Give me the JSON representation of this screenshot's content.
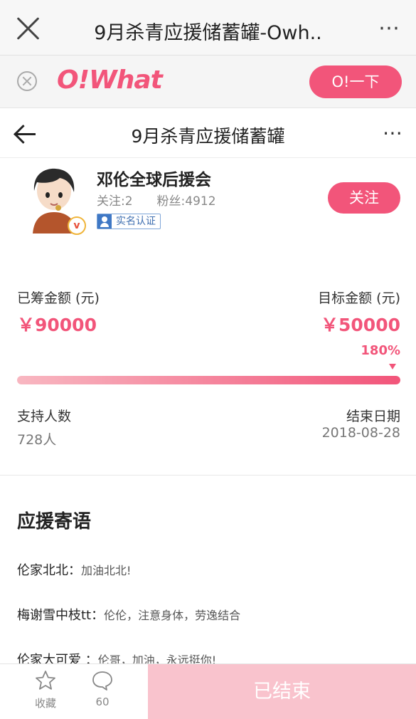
{
  "browser": {
    "title": "9月杀青应援储蓄罐-Owh..",
    "more_icon": "⋯"
  },
  "banner": {
    "logo_text": "O!What",
    "open_button": "O!一下"
  },
  "header": {
    "title": "9月杀青应援储蓄罐",
    "more_icon": "⋯"
  },
  "profile": {
    "name": "邓伦全球后援会",
    "following": "关注:2",
    "fans": "粉丝:4912",
    "verified_badge": "实名认证",
    "v_badge": "v",
    "follow_button": "关注"
  },
  "funding": {
    "raised_label": "已筹金额 (元)",
    "raised_value": "￥90000",
    "target_label": "目标金额 (元)",
    "target_value": "￥50000",
    "progress_text": "180%",
    "progress_fraction": 1.0,
    "supporters_label": "支持人数",
    "supporters_value": "728人",
    "end_date_label": "结束日期",
    "end_date_value": "2018-08-28"
  },
  "messages": {
    "title": "应援寄语",
    "items": [
      {
        "author": "伦家北北：",
        "text": "加油北北!"
      },
      {
        "author": "梅谢雪中枝tt：",
        "text": "伦伦，注意身体，劳逸结合"
      },
      {
        "author": "伦家大可爱 ：",
        "text": "伦哥，加油，永远挺你!"
      }
    ]
  },
  "bottom_bar": {
    "favorite_label": "收藏",
    "comment_count": "60",
    "ended_button": "已结束"
  },
  "colors": {
    "accent": "#f2557a",
    "ended_button": "#f9c3cd"
  }
}
